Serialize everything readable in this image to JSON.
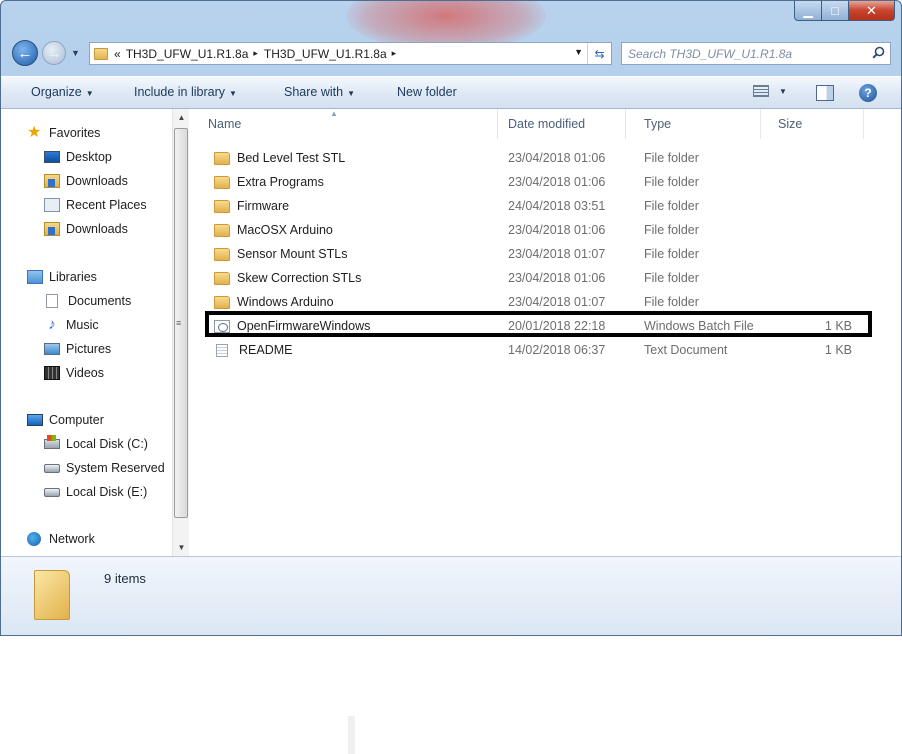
{
  "window": {
    "address": {
      "overflow_glyph": "«",
      "crumbs": [
        "TH3D_UFW_U1.R1.8a",
        "TH3D_UFW_U1.R1.8a"
      ],
      "separator": "▸"
    },
    "search_placeholder": "Search TH3D_UFW_U1.R1.8a",
    "controls": {
      "minimize": "▁",
      "maximize": "□",
      "close": "✕"
    }
  },
  "toolbar": {
    "organize": "Organize",
    "include_in_library": "Include in library",
    "share_with": "Share with",
    "new_folder": "New folder",
    "help": "?"
  },
  "nav": {
    "favorites": {
      "label": "Favorites",
      "items": [
        "Desktop",
        "Downloads",
        "Recent Places",
        "Downloads"
      ]
    },
    "libraries": {
      "label": "Libraries",
      "items": [
        "Documents",
        "Music",
        "Pictures",
        "Videos"
      ]
    },
    "computer": {
      "label": "Computer",
      "items": [
        "Local Disk (C:)",
        "System Reserved",
        "Local Disk (E:)"
      ]
    },
    "network": {
      "label": "Network"
    }
  },
  "columns": {
    "name": "Name",
    "date": "Date modified",
    "type": "Type",
    "size": "Size"
  },
  "files": [
    {
      "name": "Bed Level Test STL",
      "date": "23/04/2018 01:06",
      "type": "File folder",
      "size": "",
      "icon": "folder-icon"
    },
    {
      "name": "Extra Programs",
      "date": "23/04/2018 01:06",
      "type": "File folder",
      "size": "",
      "icon": "folder-icon"
    },
    {
      "name": "Firmware",
      "date": "24/04/2018 03:51",
      "type": "File folder",
      "size": "",
      "icon": "folder-icon"
    },
    {
      "name": "MacOSX Arduino",
      "date": "23/04/2018 01:06",
      "type": "File folder",
      "size": "",
      "icon": "folder-icon"
    },
    {
      "name": "Sensor Mount STLs",
      "date": "23/04/2018 01:07",
      "type": "File folder",
      "size": "",
      "icon": "folder-icon"
    },
    {
      "name": "Skew Correction STLs",
      "date": "23/04/2018 01:06",
      "type": "File folder",
      "size": "",
      "icon": "folder-icon"
    },
    {
      "name": "Windows Arduino",
      "date": "23/04/2018 01:07",
      "type": "File folder",
      "size": "",
      "icon": "folder-icon"
    },
    {
      "name": "OpenFirmwareWindows",
      "date": "20/01/2018 22:18",
      "type": "Windows Batch File",
      "size": "1 KB",
      "icon": "batch-file-icon"
    },
    {
      "name": "README",
      "date": "14/02/2018 06:37",
      "type": "Text Document",
      "size": "1 KB",
      "icon": "text-document-icon"
    }
  ],
  "details": {
    "item_count": "9 items"
  },
  "colors": {
    "highlight_border": "#000000",
    "window_frame": "#b9d3ee",
    "close_button": "#c7442d"
  }
}
